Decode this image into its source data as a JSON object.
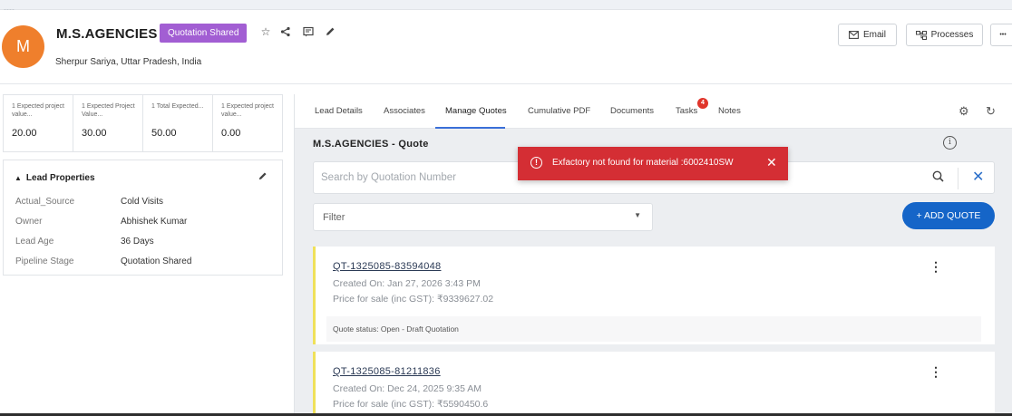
{
  "header": {
    "avatar_letter": "M",
    "account_name": "M.S.AGENCIES",
    "status": "Quotation Shared",
    "location": "Sherpur Sariya, Uttar Pradesh, India",
    "email_label": "Email",
    "processes_label": "Processes",
    "more_label": "•••"
  },
  "metrics": [
    {
      "label": "1 Expected project value...",
      "value": "20.00"
    },
    {
      "label": "1 Expected Project Value...",
      "value": "30.00"
    },
    {
      "label": "1 Total Expected...",
      "value": "50.00"
    },
    {
      "label": "1 Expected project value...",
      "value": "0.00"
    }
  ],
  "lead_properties": {
    "title": "Lead Properties",
    "rows": [
      {
        "key": "Actual_Source",
        "value": "Cold Visits"
      },
      {
        "key": "Owner",
        "value": "Abhishek Kumar"
      },
      {
        "key": "Lead Age",
        "value": "36 Days"
      },
      {
        "key": "Pipeline Stage",
        "value": "Quotation Shared"
      }
    ]
  },
  "tabs": [
    "Lead Details",
    "Associates",
    "Manage Quotes",
    "Cumulative PDF",
    "Documents",
    "Tasks",
    "Notes"
  ],
  "tasks_badge": "4",
  "quotes": {
    "title": "M.S.AGENCIES - Quote",
    "search_placeholder": "Search by Quotation Number",
    "filter_label": "Filter",
    "add_label": "+ ADD QUOTE",
    "items": [
      {
        "number": "QT-1325085-83594048",
        "created": "Created On: Jan 27, 2026 3:43 PM",
        "price": "Price for sale (inc GST): ₹9339627.02",
        "status": "Quote status: Open - Draft Quotation"
      },
      {
        "number": "QT-1325085-81211836",
        "created": "Created On: Dec 24, 2025 9:35 AM",
        "price": "Price for sale (inc GST): ₹5590450.6"
      }
    ]
  },
  "toast": {
    "message": "Exfactory not found for material :6002410SW"
  },
  "colors": {
    "avatar": "#ef7f2c",
    "status_pill": "#a25ed3",
    "primary": "#1565c8",
    "toast": "#d42e34",
    "card_accent": "#f0e15a"
  }
}
